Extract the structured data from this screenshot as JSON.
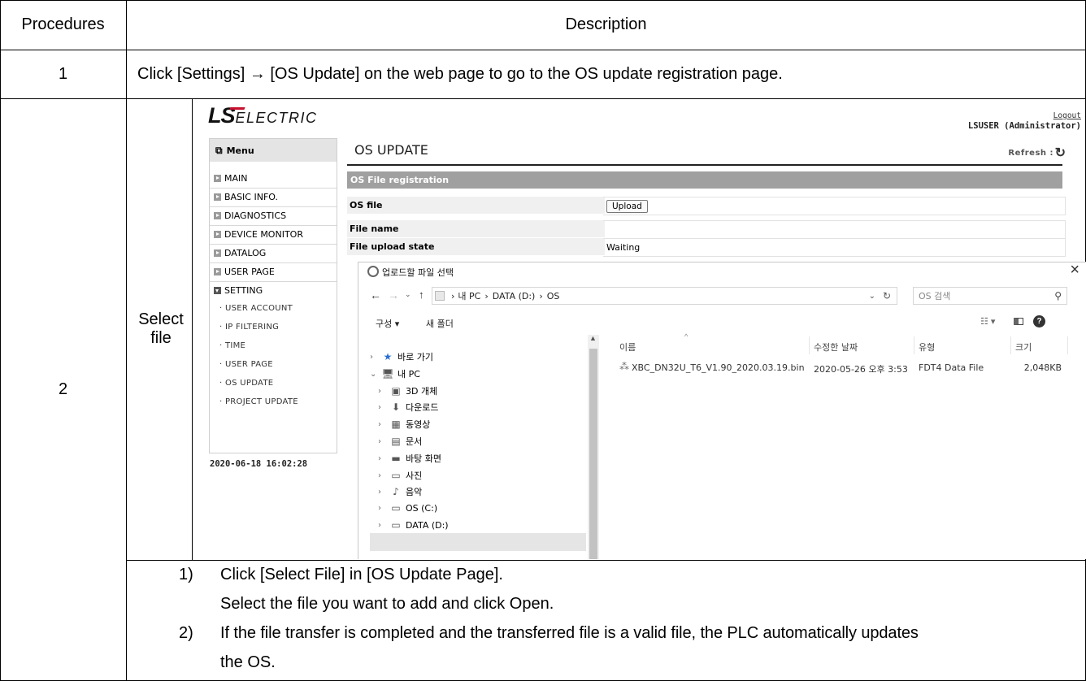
{
  "table": {
    "headers": {
      "procedures": "Procedures",
      "description": "Description"
    },
    "row1": {
      "num": "1",
      "text": "Click [Settings] → [OS Update] on the web page to go to the OS update registration page."
    },
    "row2": {
      "num": "2",
      "step_label": "Select file",
      "notes": [
        {
          "num": "1)",
          "lines": [
            "Click [Select File] in [OS Update Page].",
            "Select the file you want to add and click Open."
          ]
        },
        {
          "num": "2)",
          "lines": [
            "If the file transfer is completed and the transferred file is a valid file, the PLC automatically updates",
            "the OS."
          ]
        }
      ]
    }
  },
  "web": {
    "logo": {
      "ls": "LS",
      "electric": "ELECTRIC"
    },
    "logout": "Logout",
    "user": "LSUSER (Administrator)",
    "menu_title": "Menu",
    "menu_items": [
      "MAIN",
      "BASIC INFO.",
      "DIAGNOSTICS",
      "DEVICE MONITOR",
      "DATALOG",
      "USER PAGE",
      "SETTING"
    ],
    "setting_sub": [
      "· USER ACCOUNT",
      "· IP FILTERING",
      "· TIME",
      "· USER PAGE",
      "· OS UPDATE",
      "· PROJECT UPDATE"
    ],
    "datetime": "2020-06-18 16:02:28",
    "page_title": "OS UPDATE",
    "refresh": "Refresh :",
    "section": "OS File registration",
    "rows": [
      {
        "label": "OS file",
        "value": ""
      },
      {
        "label": "File name",
        "value": ""
      },
      {
        "label": "File upload state",
        "value": "Waiting"
      }
    ],
    "upload_btn": "Upload"
  },
  "dialog": {
    "title": "업로드할 파일 선택",
    "close": "×",
    "path": [
      "내 PC",
      "DATA (D:)",
      "OS"
    ],
    "search_placeholder": "OS 검색",
    "organize": "구성 ▾",
    "new_folder": "새 폴더",
    "tree": [
      {
        "label": "바로 가기",
        "icon": "star-icon",
        "glyph": "★",
        "indent": 0,
        "expanded": false
      },
      {
        "label": "내 PC",
        "icon": "computer-icon",
        "glyph": "🖥",
        "indent": 0,
        "expanded": true
      },
      {
        "label": "3D 개체",
        "icon": "cube-icon",
        "glyph": "▣",
        "indent": 1,
        "expanded": false
      },
      {
        "label": "다운로드",
        "icon": "download-icon",
        "glyph": "⬇",
        "indent": 1,
        "expanded": false
      },
      {
        "label": "동영상",
        "icon": "video-icon",
        "glyph": "▦",
        "indent": 1,
        "expanded": false
      },
      {
        "label": "문서",
        "icon": "document-icon",
        "glyph": "▤",
        "indent": 1,
        "expanded": false
      },
      {
        "label": "바탕 화면",
        "icon": "desktop-icon",
        "glyph": "▬",
        "indent": 1,
        "expanded": false
      },
      {
        "label": "사진",
        "icon": "picture-icon",
        "glyph": "▭",
        "indent": 1,
        "expanded": false
      },
      {
        "label": "음악",
        "icon": "music-icon",
        "glyph": "♪",
        "indent": 1,
        "expanded": false
      },
      {
        "label": "OS (C:)",
        "icon": "drive-icon",
        "glyph": "▭",
        "indent": 1,
        "expanded": false
      },
      {
        "label": "DATA (D:)",
        "icon": "drive-icon",
        "glyph": "▭",
        "indent": 1,
        "expanded": false,
        "selected": true
      }
    ],
    "columns": [
      "이름",
      "수정한 날짜",
      "유형",
      "크기"
    ],
    "file": {
      "name": "XBC_DN32U_T6_V1.90_2020.03.19.bin",
      "date": "2020-05-26 오후 3:53",
      "type": "FDT4 Data File",
      "size": "2,048KB"
    }
  },
  "colors": {
    "section_bar": "#a0a0a0",
    "label_bg": "#f0f0f0",
    "logo_red": "#c8102e",
    "selected_tree": "#e5e5e5"
  }
}
